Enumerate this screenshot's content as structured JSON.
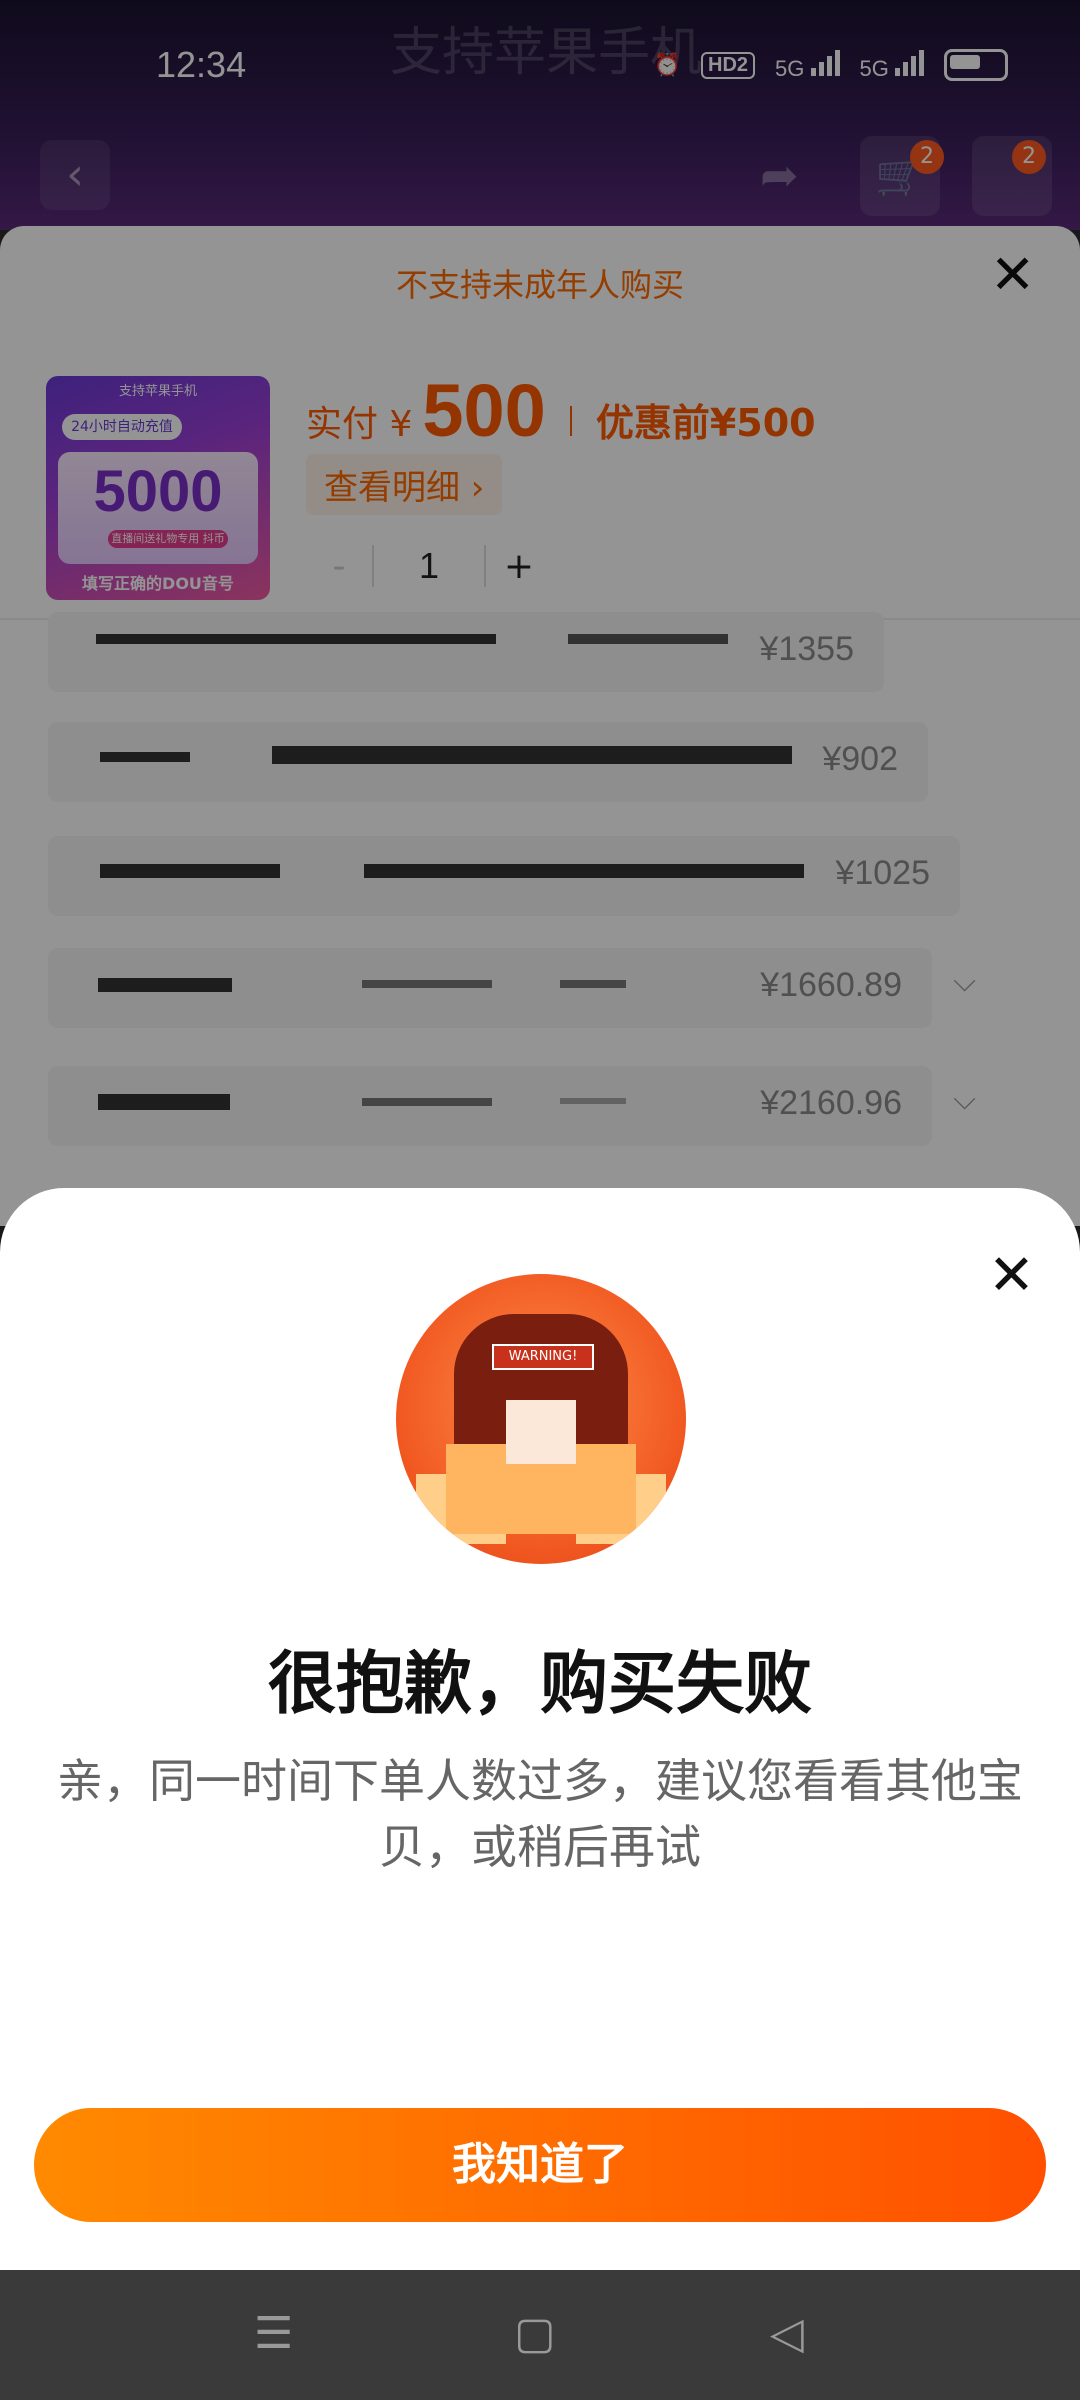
{
  "status_bar": {
    "time": "12:34",
    "hd_label": "HD2",
    "net1": "5G",
    "net2": "5G"
  },
  "background": {
    "faint_title": "支持苹果手机"
  },
  "nav": {
    "cart_badge": "2",
    "more_badge": "2"
  },
  "purchase_sheet": {
    "notice": "不支持未成年人购买",
    "thumbnail": {
      "top_text": "支持苹果手机",
      "pill_text": "24小时自动充值",
      "amount": "5000",
      "tag_text": "直播间送礼物专用 抖币",
      "footer": "填写正确的DOU音号"
    },
    "price_label": "实付 ¥",
    "price_value": "500",
    "pre_discount": "优惠前¥500",
    "detail_link": "查看明细 ›",
    "quantity": {
      "minus": "-",
      "value": "1",
      "plus": "+"
    },
    "options": [
      {
        "price": "¥1355"
      },
      {
        "price": "¥902"
      },
      {
        "price": "¥1025"
      },
      {
        "price": "¥1660.89"
      },
      {
        "price": "¥2160.96"
      }
    ]
  },
  "error_modal": {
    "illustration_sign": "WARNING!",
    "title": "很抱歉，购买失败",
    "message": "亲，同一时间下单人数过多，建议您看看其他宝贝，或稍后再试",
    "button": "我知道了"
  },
  "system_nav": {
    "menu": "☰",
    "home": "▢",
    "back": "◁"
  }
}
